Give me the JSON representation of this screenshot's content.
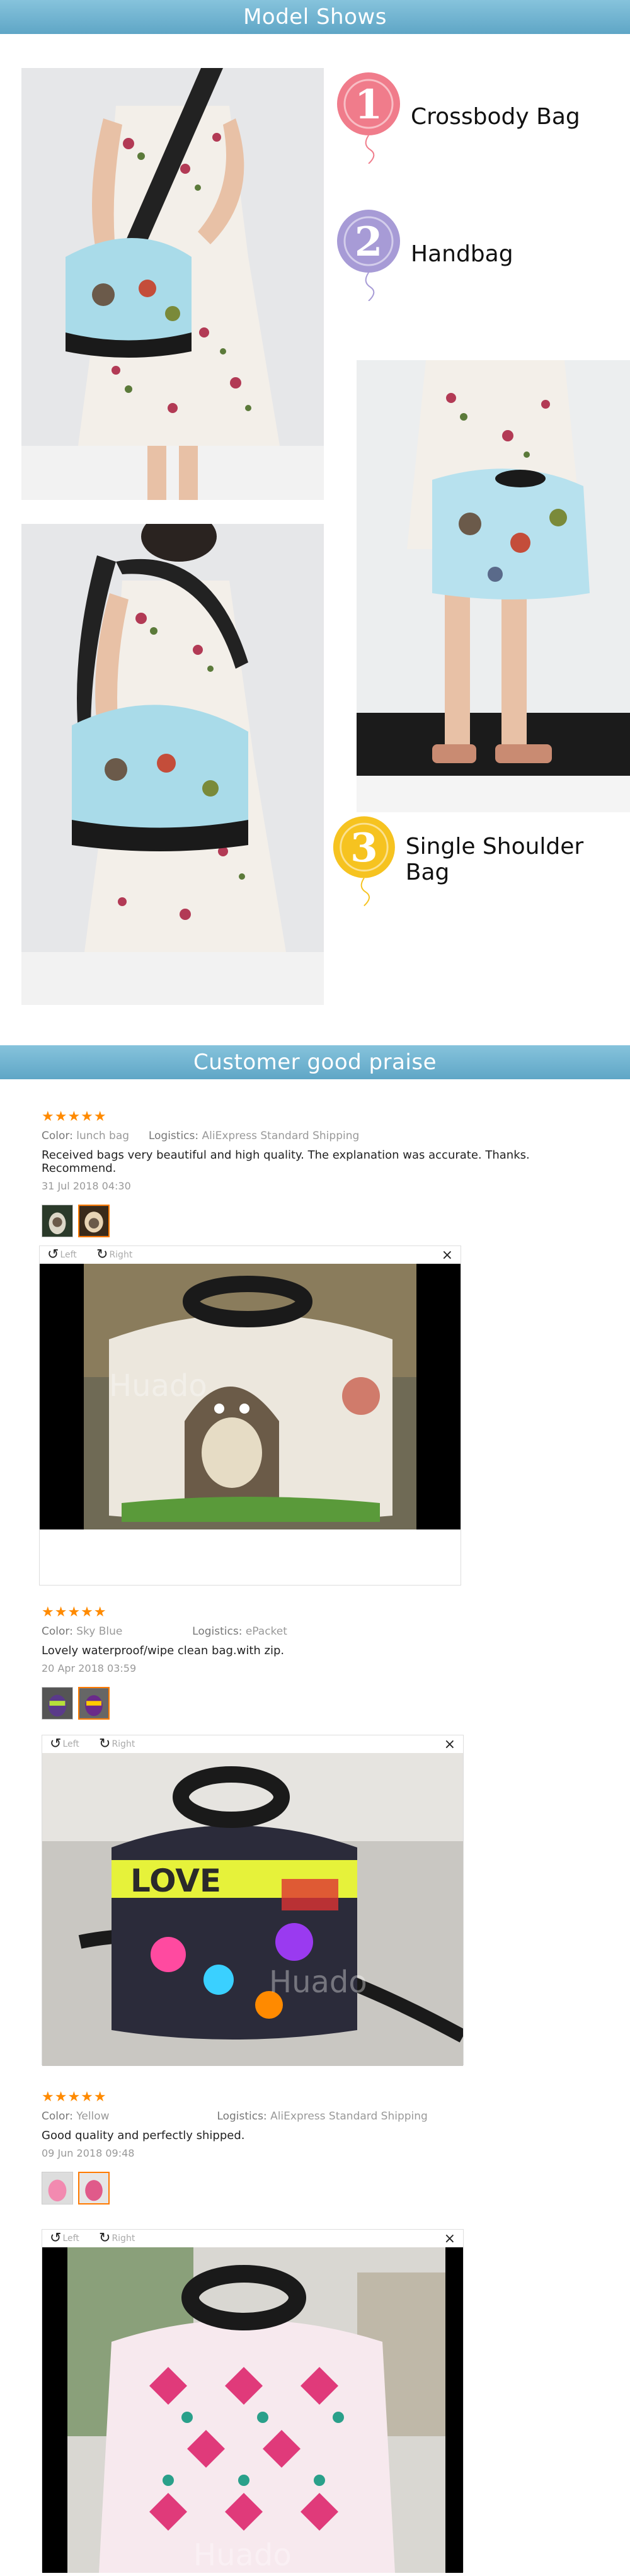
{
  "banners": {
    "model_shows": "Model Shows",
    "customer_praise": "Customer good praise"
  },
  "models": [
    {
      "number": "1",
      "label": "Crossbody Bag",
      "color": "#f07c8b"
    },
    {
      "number": "2",
      "label": "Handbag",
      "color": "#a79bd6"
    },
    {
      "number": "3",
      "label": "Single Shoulder Bag",
      "color": "#f6c320"
    }
  ],
  "reviews": [
    {
      "stars": "★★★★★",
      "color_label": "Color:",
      "color_value": "lunch bag",
      "logistics_label": "Logistics:",
      "logistics_value": "AliExpress Standard Shipping",
      "text": "Received bags very beautiful and high quality. The explanation was accurate. Thanks. Recommend.",
      "date": "31 Jul 2018 04:30",
      "watermark": "Huado"
    },
    {
      "stars": "★★★★★",
      "color_label": "Color:",
      "color_value": "Sky Blue",
      "logistics_label": "Logistics:",
      "logistics_value": "ePacket",
      "text": "Lovely waterproof/wipe clean bag.with zip.",
      "date": "20 Apr 2018 03:59",
      "watermark": "Huado"
    },
    {
      "stars": "★★★★★",
      "color_label": "Color:",
      "color_value": "Yellow",
      "logistics_label": "Logistics:",
      "logistics_value": "AliExpress Standard Shipping",
      "text": "Good quality and perfectly shipped.",
      "date": "09 Jun 2018 09:48",
      "watermark": "Huado"
    }
  ],
  "viewer": {
    "rotate_left": "Left",
    "rotate_right": "Right",
    "close": "×"
  },
  "colors": {
    "banner": "#6fb2d0",
    "stars": "#ff8a00"
  }
}
